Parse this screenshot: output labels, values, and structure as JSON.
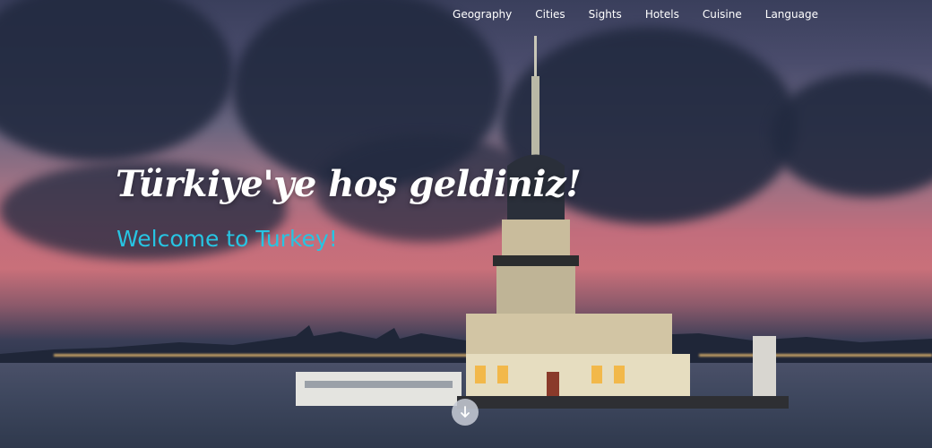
{
  "nav": {
    "items": [
      {
        "label": "Geography"
      },
      {
        "label": "Cities"
      },
      {
        "label": "Sights"
      },
      {
        "label": "Hotels"
      },
      {
        "label": "Cuisine"
      },
      {
        "label": "Language"
      }
    ]
  },
  "hero": {
    "headline": "Türkiye'ye hoş geldiniz!",
    "subheadline": "Welcome to Turkey!",
    "background_image": "maidens-tower-istanbul-sunset",
    "scroll_icon": "arrow-down-icon"
  },
  "colors": {
    "headline": "#ffffff",
    "subheadline": "#27c4e2",
    "nav_text": "#ffffff"
  }
}
